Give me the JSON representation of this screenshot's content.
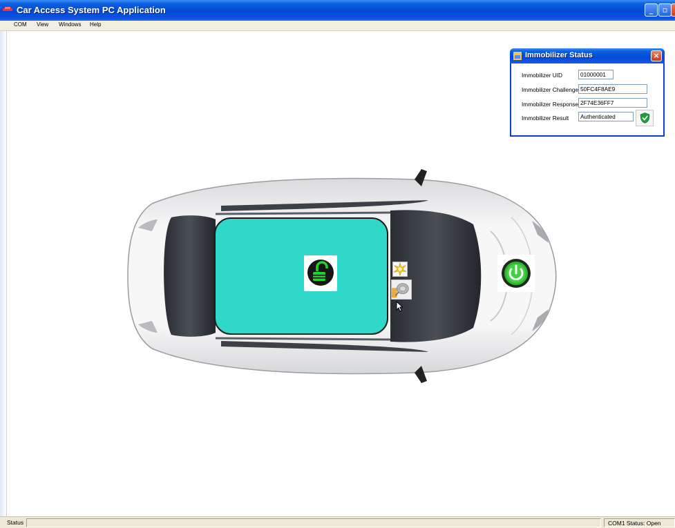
{
  "window": {
    "title": "Car Access System PC Application",
    "controls": {
      "minimize": "_",
      "maximize": "▫",
      "close": "×"
    }
  },
  "menu": [
    "COM",
    "View",
    "Windows",
    "Help"
  ],
  "immobilizer": {
    "title": "Immobilizer Status",
    "close": "×",
    "fields": [
      {
        "label": "Immobilizer UID",
        "value": "01000001"
      },
      {
        "label": "Immobilizer Challenge",
        "value": "50FC4F8AE9"
      },
      {
        "label": "Immobilizer Response",
        "value": "2F74E36FF7"
      },
      {
        "label": "Immobilizer Result",
        "value": "Authenticated"
      }
    ]
  },
  "statusbar": {
    "label": "Status",
    "com_status": "COM1 Status: Open"
  },
  "colors": {
    "sunroof": "#2fd8c8",
    "titlebar": "#0348d8",
    "lock": "#22d12a",
    "power": "#2fb52f"
  },
  "icons": {
    "lock": "unlock-icon",
    "light": "headlight-icon",
    "horn": "horn-icon",
    "power": "power-icon",
    "result": "shield-check-icon"
  }
}
